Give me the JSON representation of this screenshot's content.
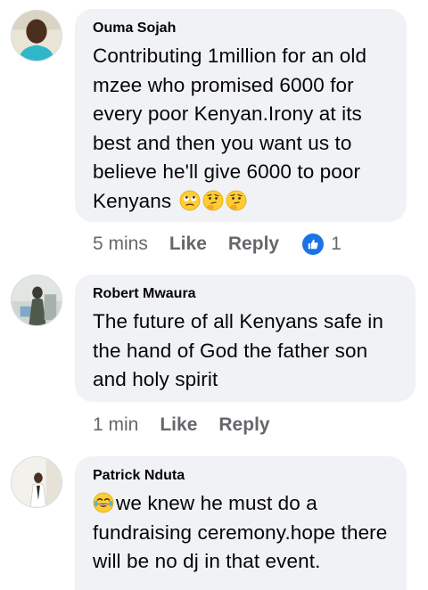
{
  "comments": [
    {
      "author": "Ouma Sojah",
      "text": "Contributing 1million for an old mzee who promised 6000 for every poor Kenyan.Irony at its best and then you want us to believe he'll give 6000 to poor Kenyans",
      "emojis_after": [
        "face-with-rolling-eyes-emoji",
        "thinking-face-emoji",
        "thinking-face-emoji"
      ],
      "time": "5 mins",
      "like_label": "Like",
      "reply_label": "Reply",
      "reaction_count": "1"
    },
    {
      "author": "Robert Mwaura",
      "text": "The future of all Kenyans safe in the hand of God the father son and holy spirit",
      "time": "1 min",
      "like_label": "Like",
      "reply_label": "Reply"
    },
    {
      "author": "Patrick Nduta",
      "emoji_before": "face-with-tears-of-joy-emoji",
      "text": "we knew he must do a fundraising ceremony.hope there will be no dj in that event."
    }
  ],
  "colors": {
    "bubble_bg": "#f0f2f5",
    "meta_text": "#65676b",
    "like_badge": "#1b74e4"
  }
}
